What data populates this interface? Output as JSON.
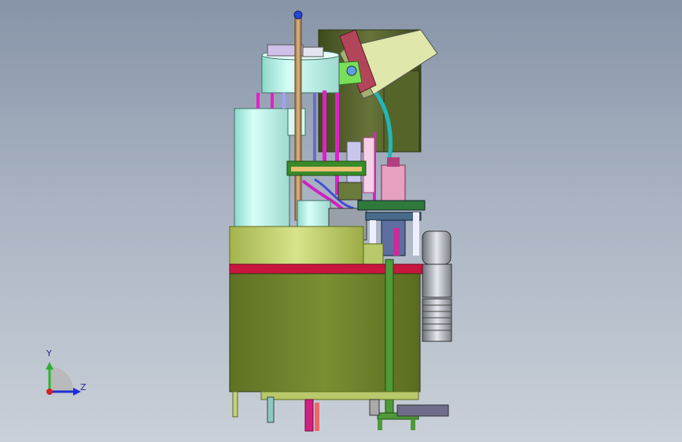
{
  "viewport": {
    "background_top": "#8794a8",
    "background_bottom": "#c9d0d9"
  },
  "triad": {
    "y_label": "Y",
    "z_label": "Z",
    "y_color": "#2bb52b",
    "z_color": "#1e2fd6",
    "origin_color": "#d61e1e"
  },
  "model": {
    "cabinet_color": "#6a7d2a",
    "table_color": "#c81e4a",
    "tank_color": "#b8f0e6",
    "motor_color": "#9a9ea6",
    "hopper_color": "#d9e2a4",
    "accent_magenta": "#e020c8",
    "accent_green": "#3d8a2a"
  }
}
